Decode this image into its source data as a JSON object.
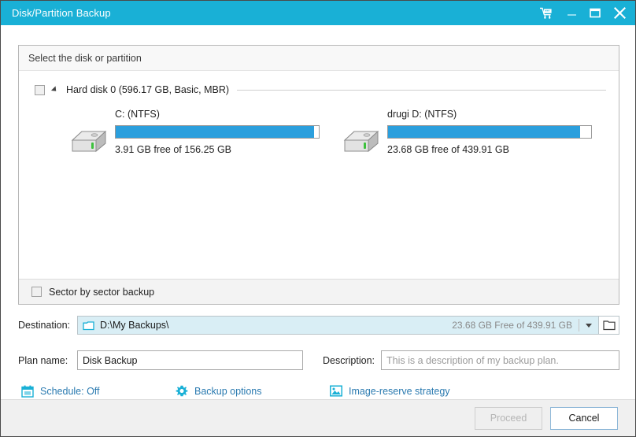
{
  "window": {
    "title": "Disk/Partition Backup",
    "accent_color": "#19b0d6",
    "controls": {
      "cart": "cart-icon",
      "minimize": "minimize-icon",
      "maximize": "maximize-icon",
      "close": "close-icon"
    }
  },
  "select_panel": {
    "header": "Select the disk or partition",
    "disk": {
      "label": "Hard disk 0 (596.17 GB, Basic, MBR)",
      "checked": false,
      "expanded": true
    },
    "partitions": [
      {
        "name": "C: (NTFS)",
        "free_text": "3.91 GB free of 156.25 GB",
        "free_gb": 3.91,
        "total_gb": 156.25,
        "used_percent": 97.5,
        "bar_color": "#2b9fdd",
        "icon": "hard-drive-icon"
      },
      {
        "name": "drugi D: (NTFS)",
        "free_text": "23.68 GB free of 439.91 GB",
        "free_gb": 23.68,
        "total_gb": 439.91,
        "used_percent": 94.6,
        "bar_color": "#2b9fdd",
        "icon": "hard-drive-icon"
      }
    ],
    "sector_backup": {
      "label": "Sector by sector backup",
      "checked": false
    }
  },
  "destination": {
    "label": "Destination:",
    "path": "D:\\My Backups\\",
    "free_space": "23.68 GB Free of 439.91 GB",
    "folder_icon": "folder-icon",
    "dropdown_icon": "chevron-down-icon",
    "browse_icon": "folder-open-icon"
  },
  "plan": {
    "name_label": "Plan name:",
    "name_value": "Disk Backup",
    "description_label": "Description:",
    "description_value": "",
    "description_placeholder": "This is a description of my backup plan."
  },
  "links": [
    {
      "label": "Schedule: Off",
      "icon": "calendar-icon"
    },
    {
      "label": "Backup options",
      "icon": "gear-icon"
    },
    {
      "label": "Image-reserve strategy",
      "icon": "image-icon"
    }
  ],
  "footer": {
    "proceed_label": "Proceed",
    "proceed_enabled": false,
    "cancel_label": "Cancel"
  }
}
